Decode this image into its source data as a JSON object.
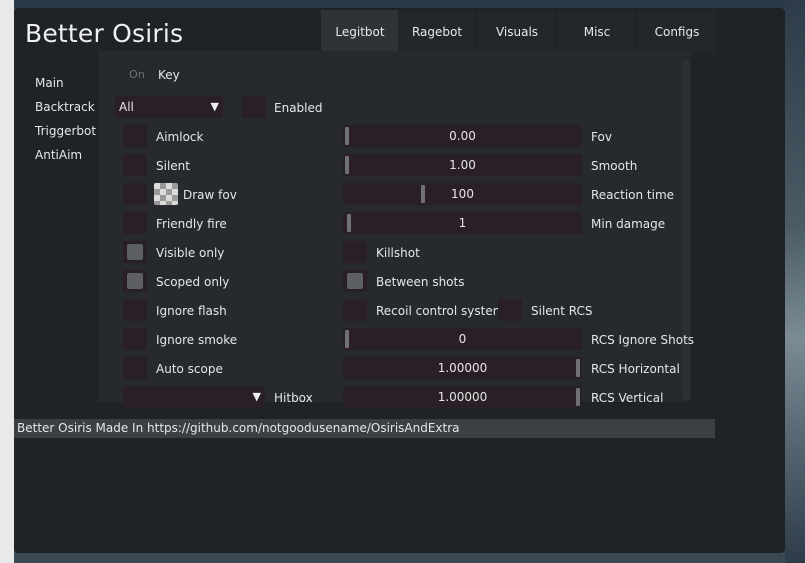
{
  "window": {
    "title": "Better Osiris"
  },
  "tabs": [
    {
      "label": "Legitbot",
      "active": true
    },
    {
      "label": "Ragebot",
      "active": false
    },
    {
      "label": "Visuals",
      "active": false
    },
    {
      "label": "Misc",
      "active": false
    },
    {
      "label": "Configs",
      "active": false
    }
  ],
  "sidebar": {
    "items": [
      "Main",
      "Backtrack",
      "Triggerbot",
      "AntiAim"
    ]
  },
  "key_bind": {
    "state": "On",
    "label": "Key"
  },
  "weapon_combo": {
    "value": "All"
  },
  "enabled": {
    "label": "Enabled",
    "checked": false
  },
  "left_options": [
    {
      "label": "Aimlock",
      "checked": false
    },
    {
      "label": "Silent",
      "checked": false
    },
    {
      "label": "Draw fov",
      "checked": false,
      "color_swatch": true
    },
    {
      "label": "Friendly fire",
      "checked": false
    },
    {
      "label": "Visible only",
      "checked": true
    },
    {
      "label": "Scoped only",
      "checked": true
    },
    {
      "label": "Ignore flash",
      "checked": false
    },
    {
      "label": "Ignore smoke",
      "checked": false
    },
    {
      "label": "Auto scope",
      "checked": false
    }
  ],
  "hitbox": {
    "label": "Hitbox",
    "value": ""
  },
  "sliders": {
    "fov": {
      "label": "Fov",
      "value": "0.00",
      "fraction": 0.0
    },
    "smooth": {
      "label": "Smooth",
      "value": "1.00",
      "fraction": 0.0
    },
    "reaction_time": {
      "label": "Reaction time",
      "value": "100",
      "fraction": 0.33
    },
    "min_damage": {
      "label": "Min damage",
      "value": "1",
      "fraction": 0.01
    },
    "rcs_ignore_shots": {
      "label": "RCS Ignore Shots",
      "value": "0",
      "fraction": 0.0
    },
    "rcs_horizontal": {
      "label": "RCS Horizontal",
      "value": "1.00000",
      "fraction": 1.0
    },
    "rcs_vertical": {
      "label": "RCS Vertical",
      "value": "1.00000",
      "fraction": 1.0
    }
  },
  "right_checks": {
    "killshot": {
      "label": "Killshot",
      "checked": false
    },
    "between_shots": {
      "label": "Between shots",
      "checked": true
    },
    "rcs": {
      "label": "Recoil control system",
      "checked": false
    },
    "silent_rcs": {
      "label": "Silent RCS",
      "checked": false
    }
  },
  "status": {
    "text": "Better Osiris Made In https://github.com/notgoodusename/OsirisAndExtra"
  },
  "colors": {
    "window_bg": "#1f2327",
    "frame_bg": "#2a1f26",
    "active_tab": "#2e3338"
  }
}
